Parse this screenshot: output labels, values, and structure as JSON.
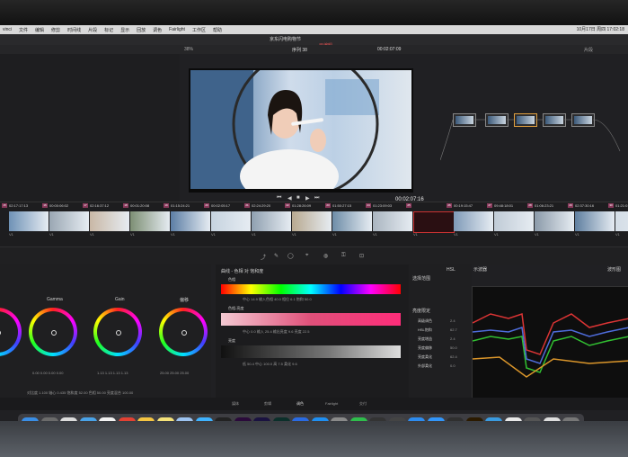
{
  "menubar": {
    "items": [
      "vinci",
      "文件",
      "编辑",
      "修剪",
      "时间线",
      "片段",
      "标记",
      "显示",
      "回放",
      "调色",
      "Fairlight",
      "工作区",
      "帮助"
    ],
    "clock": "10月17日 周四 17:02:18"
  },
  "titlebar": {
    "project_line": "京东闪电购物节",
    "status": "已编辑"
  },
  "viewer": {
    "zoom": "38%",
    "clip_name": "序列 38",
    "timecode_top": "00:02:07:09",
    "timecode": "00:02:07:16",
    "mode_label": "片段"
  },
  "timeline": {
    "clips": [
      {
        "num": "15",
        "tc": "02:17:17:13",
        "cap": "V1"
      },
      {
        "num": "16",
        "tc": "00:00:06:02",
        "cap": "V1"
      },
      {
        "num": "17",
        "tc": "02:16:37:12",
        "cap": "V1"
      },
      {
        "num": "18",
        "tc": "00:01:20:08",
        "cap": "V1"
      },
      {
        "num": "19",
        "tc": "01:15:24:21",
        "cap": "V1"
      },
      {
        "num": "20",
        "tc": "00:02:05:17",
        "cap": "V1"
      },
      {
        "num": "21",
        "tc": "02:24:29:20",
        "cap": "V1"
      },
      {
        "num": "22",
        "tc": "01:28:26:09",
        "cap": "V1"
      },
      {
        "num": "23",
        "tc": "01:50:27:15",
        "cap": "V1"
      },
      {
        "num": "24",
        "tc": "01:23:09:03",
        "cap": "V1"
      },
      {
        "num": "25",
        "tc": "",
        "cap": "V1"
      },
      {
        "num": "26",
        "tc": "00:19:15:47",
        "cap": "V1"
      },
      {
        "num": "27",
        "tc": "09:48:18:01",
        "cap": "V1"
      },
      {
        "num": "28",
        "tc": "01:06:23:21",
        "cap": "V1"
      },
      {
        "num": "29",
        "tc": "02:37:30:16",
        "cap": "V1"
      },
      {
        "num": "30",
        "tc": "01:21:01:15",
        "cap": "V1"
      }
    ]
  },
  "wheels": [
    {
      "name": "Gamma",
      "vals": "0.00  0.00  0.00  0.00"
    },
    {
      "name": "Gain",
      "vals": "1.13  1.13  1.13  1.13"
    },
    {
      "name": "偏移",
      "vals": "25.00  25.00  25.00"
    }
  ],
  "wheels_footer": "对比度 1.100   轴心 0.435   饱和度 52.00   色相 50.00   亮度混合 100.00",
  "curves": {
    "title": "曲线 - 色相 对 饱和度",
    "rows": [
      {
        "label": "色相",
        "vals": "中心  14.9    输入色相  40.0    相位  6.1    饱和  50.0"
      },
      {
        "label": "色相-亮度",
        "vals": "中心  0.0    输入  25.4    输出亮度  9.6    亮度  22.5"
      },
      {
        "label": "亮度",
        "vals": "低  50.4    中心  100.0    高  7.5    柔化  9.6"
      }
    ]
  },
  "qualifier": {
    "title": "选择范围",
    "subtitle": "亮度限定",
    "mode": "HSL",
    "vals": [
      {
        "label": "高级调色",
        "value": "2.4"
      },
      {
        "label": "HSL饱和",
        "value": "62.7"
      },
      {
        "label": "亮度增益",
        "value": "2.4"
      },
      {
        "label": "亮度偏移",
        "value": "50.0"
      },
      {
        "label": "亮度柔化",
        "value": "62.4"
      },
      {
        "label": "外部柔化",
        "value": "0.0"
      }
    ]
  },
  "scope": {
    "title": "示波器",
    "mode": "波形图"
  },
  "page_tabs": [
    "媒体",
    "剪辑",
    "调色",
    "Fairlight",
    "交付"
  ],
  "dock": {
    "apps": [
      {
        "icon": "finder-icon",
        "label": "",
        "color": "#3a8ee6"
      },
      {
        "icon": "launchpad-icon",
        "label": "",
        "color": "#6b6b6b"
      },
      {
        "icon": "chrome-icon",
        "label": "",
        "color": "#dcdcdc"
      },
      {
        "icon": "safari-icon",
        "label": "",
        "color": "#4aa3e8"
      },
      {
        "icon": "calendar-icon",
        "label": "17",
        "color": "#f2f2f2"
      },
      {
        "icon": "chrome2-icon",
        "label": "",
        "color": "#e34133"
      },
      {
        "icon": "photos-icon",
        "label": "",
        "color": "#f5c542"
      },
      {
        "icon": "notes-icon",
        "label": "",
        "color": "#f5e27a"
      },
      {
        "icon": "preview-icon",
        "label": "",
        "color": "#9dc3f0"
      },
      {
        "icon": "messages-icon",
        "label": "",
        "color": "#3fb3ff"
      },
      {
        "icon": "qq-icon",
        "label": "",
        "color": "#222"
      },
      {
        "icon": "premiere-icon",
        "label": "Pr",
        "color": "#2a0a3a"
      },
      {
        "icon": "aftereffects-icon",
        "label": "Ae",
        "color": "#1a1240"
      },
      {
        "icon": "audition-icon",
        "label": "Au",
        "color": "#0b2f2a"
      },
      {
        "icon": "baidu-icon",
        "label": "",
        "color": "#2a6be3"
      },
      {
        "icon": "appstore-icon",
        "label": "",
        "color": "#1f8ff2"
      },
      {
        "icon": "settings-icon",
        "label": "",
        "color": "#8a8a8a"
      },
      {
        "icon": "wechat-icon",
        "label": "",
        "color": "#2fbd4c"
      },
      {
        "icon": "finalcut-icon",
        "label": "",
        "color": "#333"
      },
      {
        "icon": "quicktime-icon",
        "label": "",
        "color": "#444"
      },
      {
        "icon": "thunder-icon",
        "label": "",
        "color": "#2d8cf0"
      },
      {
        "icon": "dingtalk-icon",
        "label": "",
        "color": "#3296fa"
      },
      {
        "icon": "resolve-icon",
        "label": "",
        "color": "#2f2f2f"
      },
      {
        "icon": "illustrator-icon",
        "label": "Ai",
        "color": "#2b1a00"
      },
      {
        "icon": "wechat-work-icon",
        "label": "",
        "color": "#3a9be0"
      },
      {
        "icon": "folder-icon",
        "label": "",
        "color": "#e8e8e8"
      },
      {
        "icon": "screen-icon",
        "label": "",
        "color": "#555"
      },
      {
        "icon": "doc-icon",
        "label": "",
        "color": "#ddd"
      },
      {
        "icon": "trash-icon",
        "label": "",
        "color": "#777"
      }
    ]
  }
}
